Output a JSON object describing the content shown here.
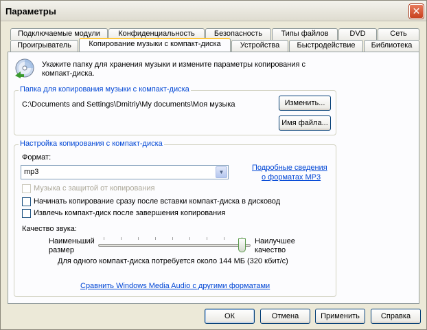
{
  "window": {
    "title": "Параметры",
    "close_symbol": "✕"
  },
  "tabs_row1": [
    "Подключаемые модули",
    "Конфиденциальность",
    "Безопасность",
    "Типы файлов",
    "DVD",
    "Сеть"
  ],
  "tabs_row2": [
    "Проигрыватель",
    "Копирование музыки с компакт-диска",
    "Устройства",
    "Быстродействие",
    "Библиотека"
  ],
  "active_tab": "Копирование музыки с компакт-диска",
  "intro": {
    "icon": "cd-icon",
    "text": "Укажите папку для хранения музыки и измените параметры копирования с компакт-диска."
  },
  "folder_group": {
    "title": "Папка для копирования музыки с компакт-диска",
    "path": "C:\\Documents and Settings\\Dmitriy\\My documents\\Моя музыка",
    "change_button": "Изменить...",
    "filename_button": "Имя файла..."
  },
  "settings_group": {
    "title": "Настройка копирования с компакт-диска",
    "format_label": "Формат:",
    "format_value": "mp3",
    "more_info_link_line1": "Подробные сведения",
    "more_info_link_line2": "о форматах MP3",
    "copy_protect_label": "Музыка с защитой от копирования",
    "copy_protect_checked": false,
    "copy_protect_enabled": false,
    "auto_rip_label": "Начинать копирование сразу после вставки компакт-диска в дисковод",
    "auto_rip_checked": false,
    "eject_label": "Извлечь компакт-диск после завершения копирования",
    "eject_checked": false,
    "quality_label": "Качество звука:",
    "smallest_line1": "Наименьший",
    "smallest_line2": "размер",
    "best_line1": "Наилучшее",
    "best_line2": "качество",
    "quality_level": 1.0,
    "size_note": "Для одного компакт-диска потребуется около  144 МБ (320 кбит/с)",
    "compare_link": "Сравнить Windows Media Audio с другими форматами"
  },
  "footer": {
    "ok": "ОК",
    "cancel": "Отмена",
    "apply": "Применить",
    "help": "Справка"
  }
}
